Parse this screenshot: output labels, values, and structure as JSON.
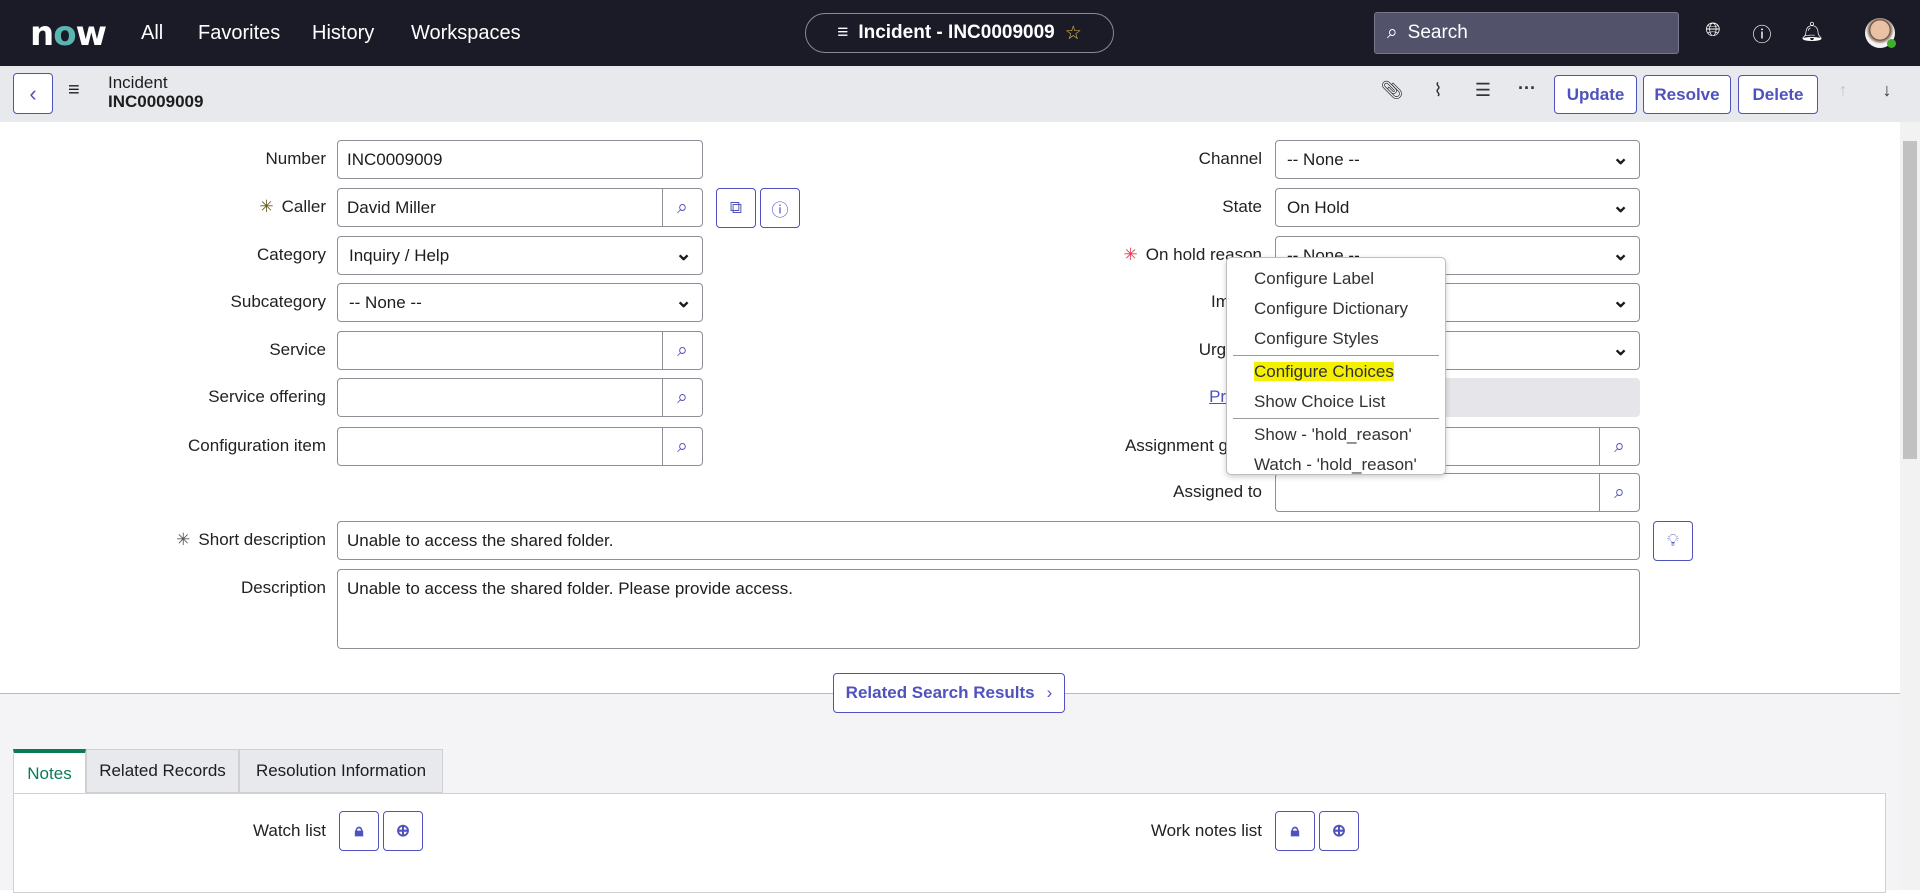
{
  "header": {
    "logo": "now",
    "nav": [
      "All",
      "Favorites",
      "History",
      "Workspaces"
    ],
    "context_title": "Incident - INC0009009",
    "search_placeholder": "Search"
  },
  "subheader": {
    "table": "Incident",
    "number": "INC0009009",
    "buttons": {
      "update": "Update",
      "resolve": "Resolve",
      "delete": "Delete"
    }
  },
  "left_fields": [
    {
      "label": "Number",
      "value": "INC0009009",
      "type": "text"
    },
    {
      "label": "Caller",
      "value": "David Miller",
      "type": "reference",
      "required": true
    },
    {
      "label": "Category",
      "value": "Inquiry / Help",
      "type": "select"
    },
    {
      "label": "Subcategory",
      "value": "-- None --",
      "type": "select"
    },
    {
      "label": "Service",
      "value": "",
      "type": "reference"
    },
    {
      "label": "Service offering",
      "value": "",
      "type": "reference"
    },
    {
      "label": "Configuration item",
      "value": "",
      "type": "reference"
    }
  ],
  "right_fields": [
    {
      "label": "Channel",
      "value": "-- None --",
      "type": "select"
    },
    {
      "label": "State",
      "value": "On Hold",
      "type": "select"
    },
    {
      "label": "On hold reason",
      "value": "-- None --",
      "type": "select",
      "required": true
    },
    {
      "label": "Impact",
      "value": "",
      "type": "select"
    },
    {
      "label": "Urgency",
      "value": "",
      "type": "select"
    },
    {
      "label": "Priority",
      "value": "",
      "type": "readonly"
    },
    {
      "label": "Assignment group",
      "value": "",
      "type": "reference"
    },
    {
      "label": "Assigned to",
      "value": "",
      "type": "reference"
    }
  ],
  "short_description": {
    "label": "Short description",
    "value": "Unable to access the shared folder."
  },
  "description": {
    "label": "Description",
    "value": "Unable to access the shared folder. Please provide access."
  },
  "context_menu": {
    "items": [
      "Configure Label",
      "Configure Dictionary",
      "Configure Styles",
      "Configure Choices",
      "Show Choice List",
      "Show - 'hold_reason'",
      "Watch - 'hold_reason'"
    ],
    "highlighted": "Configure Choices",
    "highlight_color": "#f5f000"
  },
  "related_search": "Related Search Results",
  "tabs": [
    "Notes",
    "Related Records",
    "Resolution Information"
  ],
  "active_tab": "Notes",
  "notes": {
    "watch_list": "Watch list",
    "work_notes_list": "Work notes list"
  },
  "colors": {
    "accent": "#4f52bd",
    "topbar": "#1b1b27",
    "active_tab": "#0b7a5a"
  }
}
